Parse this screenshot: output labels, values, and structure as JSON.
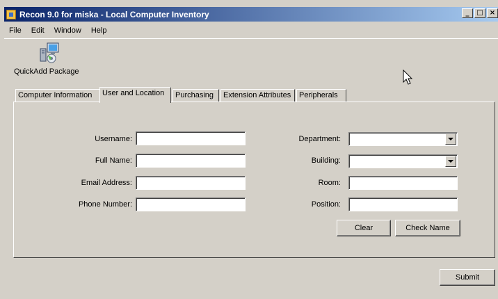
{
  "window": {
    "title": "Recon 9.0 for miska - Local Computer Inventory",
    "minimize": "_",
    "maximize": "□",
    "close": "×"
  },
  "menu": [
    "File",
    "Edit",
    "Window",
    "Help"
  ],
  "toolbar": {
    "quickadd_label": "QuickAdd Package"
  },
  "tabs": [
    "Computer Information",
    "User and Location",
    "Purchasing",
    "Extension Attributes",
    "Peripherals"
  ],
  "active_tab": "User and Location",
  "form": {
    "username": {
      "label": "Username:",
      "value": ""
    },
    "full_name": {
      "label": "Full Name:",
      "value": ""
    },
    "email": {
      "label": "Email Address:",
      "value": ""
    },
    "phone": {
      "label": "Phone Number:",
      "value": ""
    },
    "department": {
      "label": "Department:",
      "value": ""
    },
    "building": {
      "label": "Building:",
      "value": ""
    },
    "room": {
      "label": "Room:",
      "value": ""
    },
    "position": {
      "label": "Position:",
      "value": ""
    }
  },
  "buttons": {
    "clear": "Clear",
    "check_name": "Check Name",
    "submit": "Submit"
  },
  "colors": {
    "face": "#d4d0c8",
    "title_start": "#0a246a",
    "title_end": "#a6caf0"
  }
}
